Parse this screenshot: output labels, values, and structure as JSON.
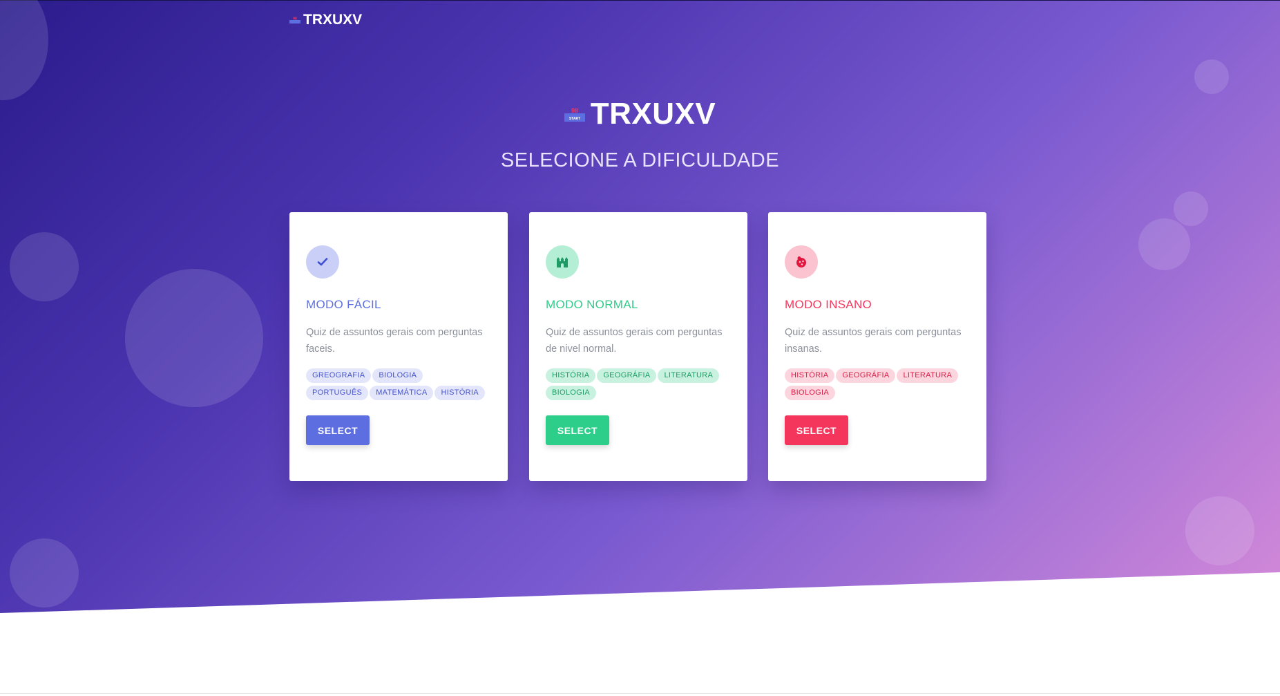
{
  "brand": {
    "name": "TRXUXV",
    "logo_top": "98",
    "logo_bottom": "START"
  },
  "hero": {
    "title": "TRXUXV",
    "subtitle": "SELECIONE A DIFICULDADE"
  },
  "colors": {
    "easy": "#5c6ee0",
    "easy_light": "#c9cff7",
    "easy_tag_bg": "#e3e6fb",
    "easy_tag_text": "#4451c9",
    "normal": "#2dce89",
    "normal_light": "#b4efd5",
    "normal_tag_bg": "#c8f2df",
    "normal_tag_text": "#1f9a65",
    "insane": "#f5365c",
    "insane_light": "#fbc3cf",
    "insane_tag_bg": "#fcd6de",
    "insane_tag_text": "#d81e48"
  },
  "cards": [
    {
      "icon": "check-icon",
      "title": "MODO FÁCIL",
      "description": "Quiz de assuntos gerais com perguntas faceis.",
      "tags": [
        "GREOGRAFIA",
        "BIOLOGIA",
        "PORTUGUÊS",
        "MATEMÁTICA",
        "HISTÓRIA"
      ],
      "button": "SELECT"
    },
    {
      "icon": "castle-icon",
      "title": "MODO NORMAL",
      "description": "Quiz de assuntos gerais com perguntas de nivel normal.",
      "tags": [
        "HISTÓRIA",
        "GEOGRÁFIA",
        "LITERATURA",
        "BIOLOGIA"
      ],
      "button": "SELECT"
    },
    {
      "icon": "ladybug-icon",
      "title": "MODO INSANO",
      "description": "Quiz de assuntos gerais com perguntas insanas.",
      "tags": [
        "HISTÓRIA",
        "GEOGRÁFIA",
        "LITERATURA",
        "BIOLOGIA"
      ],
      "button": "SELECT"
    }
  ]
}
